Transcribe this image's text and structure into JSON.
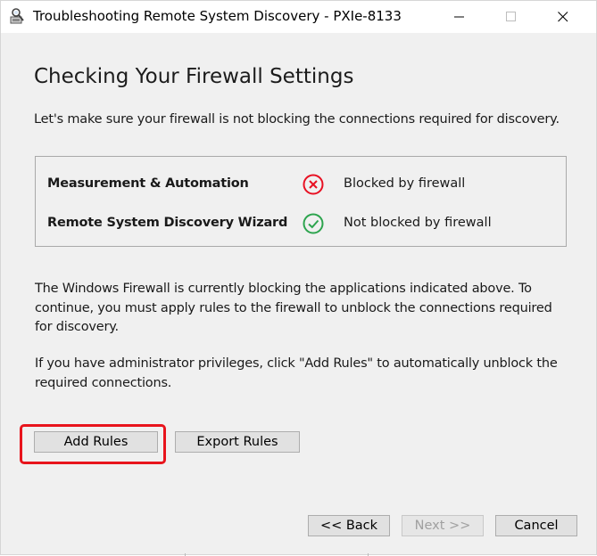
{
  "window": {
    "title": "Troubleshooting Remote System Discovery - PXIe-8133"
  },
  "page": {
    "heading": "Checking Your Firewall Settings",
    "intro": "Let's make sure your firewall is not blocking the connections required for discovery."
  },
  "status": {
    "rows": [
      {
        "app": "Measurement & Automation",
        "icon": "error-circle-x-icon",
        "status": "Blocked by firewall",
        "color": "#e81123"
      },
      {
        "app": "Remote System Discovery Wizard",
        "icon": "check-circle-icon",
        "status": "Not blocked by firewall",
        "color": "#2da44e"
      }
    ]
  },
  "text": {
    "para1": "The Windows Firewall is currently blocking the applications indicated above. To continue, you must apply rules to the firewall to unblock the connections required for discovery.",
    "para2": "If you have administrator privileges, click \"Add Rules\" to automatically unblock the required connections."
  },
  "buttons": {
    "add_rules": "Add Rules",
    "export_rules": "Export Rules",
    "back": "<< Back",
    "next": "Next >>",
    "cancel": "Cancel"
  },
  "colors": {
    "highlight": "#e8141c"
  }
}
